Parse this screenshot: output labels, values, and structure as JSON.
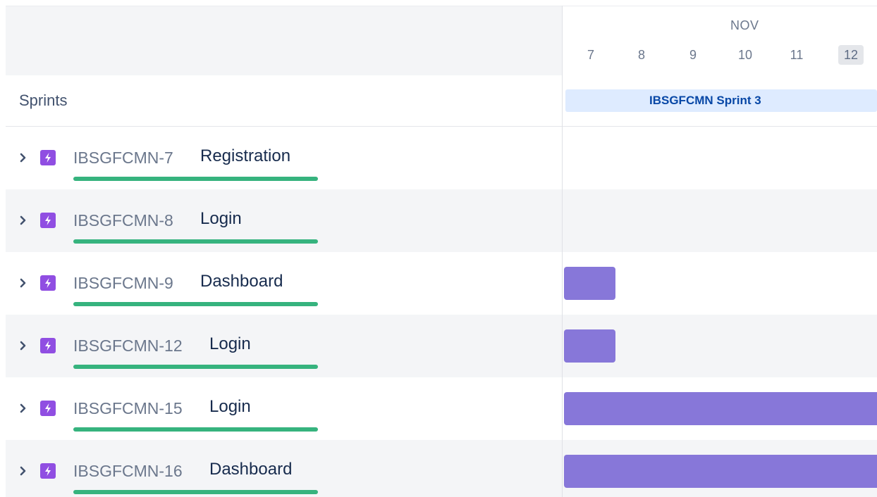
{
  "timeline": {
    "month": "NOV",
    "days": [
      "7",
      "8",
      "9",
      "10",
      "11",
      "12"
    ],
    "today": "12"
  },
  "sprints": {
    "label": "Sprints",
    "sprint_name": "IBSGFCMN Sprint 3"
  },
  "colors": {
    "progress": "#36b37e",
    "epic_icon": "#904ee2",
    "gantt_bar": "#8777d9",
    "sprint_bar": "#deebff",
    "sprint_text": "#0747a6"
  },
  "issues": [
    {
      "key": "IBSGFCMN-7",
      "title": "Registration",
      "icon": "epic-lightning-icon",
      "progress": 1.0
    },
    {
      "key": "IBSGFCMN-8",
      "title": "Login",
      "icon": "epic-lightning-icon",
      "progress": 1.0
    },
    {
      "key": "IBSGFCMN-9",
      "title": "Dashboard",
      "icon": "epic-lightning-icon",
      "progress": 1.0
    },
    {
      "key": "IBSGFCMN-12",
      "title": "Login",
      "icon": "epic-lightning-icon",
      "progress": 1.0
    },
    {
      "key": "IBSGFCMN-15",
      "title": "Login",
      "icon": "epic-lightning-icon",
      "progress": 1.0
    },
    {
      "key": "IBSGFCMN-16",
      "title": "Dashboard",
      "icon": "epic-lightning-icon",
      "progress": 1.0
    }
  ]
}
